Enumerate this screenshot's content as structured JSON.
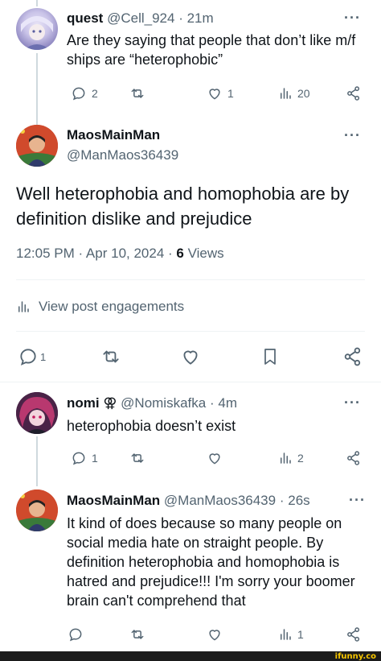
{
  "tweet1": {
    "display_name": "quest",
    "handle": "@Cell_924",
    "sep": "·",
    "time": "21m",
    "text": "Are they saying that people that don’t like m/f ships are “heterophobic”",
    "replies": "2",
    "likes": "1",
    "views": "20"
  },
  "main": {
    "display_name": "MaosMainMan",
    "handle": "@ManMaos36439",
    "text": "Well heterophobia and homophobia are by definition dislike and prejudice",
    "timestamp": "12:05 PM · Apr 10, 2024 · ",
    "views_count": "6",
    "views_label": " Views",
    "engagements": "View post engagements",
    "replies": "1"
  },
  "reply1": {
    "display_name": "nomi",
    "badge": "⚢",
    "handle": "@Nomiskafka",
    "sep": "·",
    "time": "4m",
    "text": "heterophobia doesn’t exist",
    "replies": "1",
    "views": "2"
  },
  "reply2": {
    "display_name": "MaosMainMan",
    "handle": "@ManMaos36439",
    "sep": "·",
    "time": "26s",
    "text": "It kind of does because so many people on social media hate on straight people. By definition heterophobia and homophobia is hatred and prejudice!!! I'm sorry your boomer brain can't comprehend that",
    "views": "1"
  },
  "more_label": "···",
  "watermark": "ifunny.co",
  "colors": {
    "text": "#0f1419",
    "muted": "#536471",
    "divider": "#eff3f4",
    "thread": "#cfd9de"
  }
}
